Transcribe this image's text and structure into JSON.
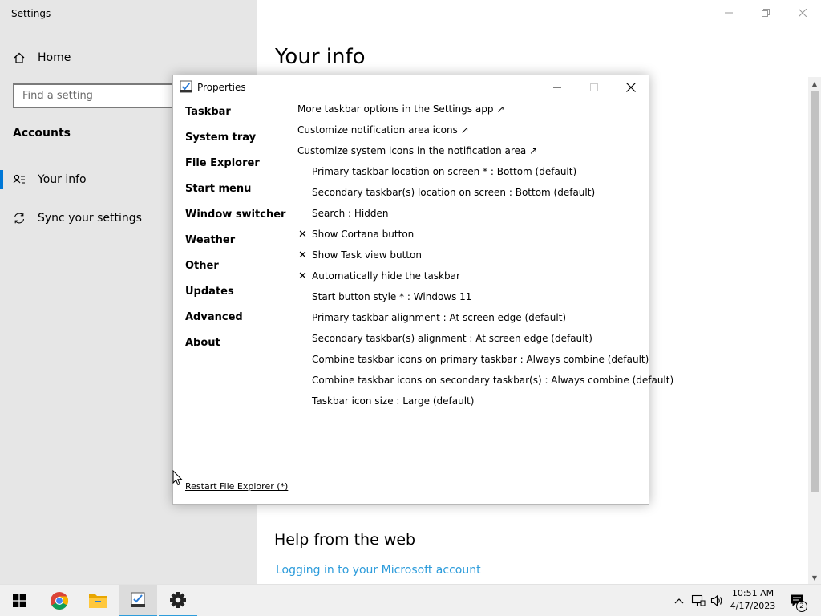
{
  "settings": {
    "title": "Settings",
    "nav_home": "Home",
    "search_placeholder": "Find a setting",
    "section_heading": "Accounts",
    "nav_items": [
      "Your info",
      "Sync your settings"
    ],
    "page_heading": "Your info",
    "help_heading": "Help from the web",
    "help_link": "Logging in to your Microsoft account"
  },
  "properties": {
    "title": "Properties",
    "nav": [
      "Taskbar",
      "System tray",
      "File Explorer",
      "Start menu",
      "Window switcher",
      "Weather",
      "Other",
      "Updates",
      "Advanced",
      "About"
    ],
    "active_nav": "Taskbar",
    "options": [
      {
        "text": "More taskbar options in the Settings app ↗",
        "kind": "link"
      },
      {
        "text": "Customize notification area icons ↗",
        "kind": "link"
      },
      {
        "text": "Customize system icons in the notification area ↗",
        "kind": "link"
      },
      {
        "text": "Primary taskbar location on screen * : Bottom (default)",
        "kind": "setting"
      },
      {
        "text": "Secondary taskbar(s) location on screen : Bottom (default)",
        "kind": "setting"
      },
      {
        "text": "Search : Hidden",
        "kind": "setting"
      },
      {
        "text": "Show Cortana button",
        "kind": "checkbox",
        "mark": "✕"
      },
      {
        "text": "Show Task view button",
        "kind": "checkbox",
        "mark": "✕"
      },
      {
        "text": "Automatically hide the taskbar",
        "kind": "checkbox",
        "mark": "✕"
      },
      {
        "text": "Start button style * : Windows 11",
        "kind": "setting"
      },
      {
        "text": "Primary taskbar alignment : At screen edge (default)",
        "kind": "setting"
      },
      {
        "text": "Secondary taskbar(s) alignment : At screen edge (default)",
        "kind": "setting"
      },
      {
        "text": "Combine taskbar icons on primary taskbar : Always combine (default)",
        "kind": "setting"
      },
      {
        "text": "Combine taskbar icons on secondary taskbar(s) : Always combine (default)",
        "kind": "setting"
      },
      {
        "text": "Taskbar icon size : Large (default)",
        "kind": "setting"
      }
    ],
    "restart_link": "Restart File Explorer (*)"
  },
  "taskbar": {
    "time": "10:51 AM",
    "date": "4/17/2023",
    "notification_count": "2",
    "apps": [
      "start-icon",
      "chrome-icon",
      "file-explorer-icon",
      "properties-app-icon",
      "settings-gear-icon"
    ]
  },
  "colors": {
    "accent": "#0078d7",
    "link": "#2d9cdb",
    "settings_sidebar": "#e6e6e6",
    "taskbar": "#f0f0f0"
  }
}
